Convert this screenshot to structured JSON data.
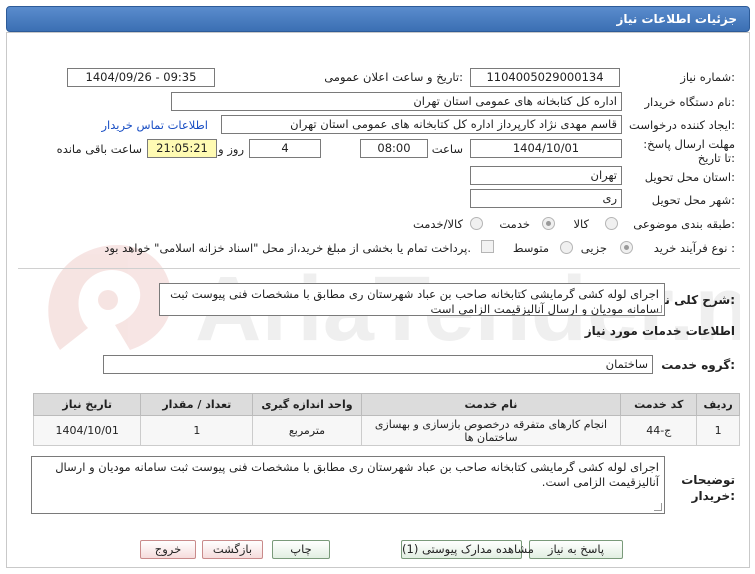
{
  "window_title": "جزئیات اطلاعات نیاز",
  "watermark_text": "AriaTender.net",
  "fields": {
    "need_number_label": "شماره نیاز:",
    "need_number": "1104005029000134",
    "announce_label": "تاریخ و ساعت اعلان عمومی:",
    "announce_value": "1404/09/26 - 09:35",
    "buyer_org_label": "نام دستگاه خریدار:",
    "buyer_org": "اداره کل کتابخانه های عمومی استان تهران",
    "creator_label": "ایجاد کننده درخواست:",
    "creator": "قاسم مهدی نژاد کارپرداز اداره کل کتابخانه های عمومی استان تهران",
    "contact_link": "اطلاعات تماس خریدار",
    "deadline_label": "مهلت ارسال پاسخ: تا تاریخ:",
    "deadline_date": "1404/10/01",
    "time_label": "ساعت",
    "deadline_time": "08:00",
    "days_value": "4",
    "days_label": "روز و",
    "remaining_time": "21:05:21",
    "remaining_label": "ساعت باقی مانده",
    "province_label": "استان محل تحویل:",
    "province": "تهران",
    "city_label": "شهر محل تحویل:",
    "city": "ری",
    "category_label": "طبقه بندی موضوعی:",
    "category_options": [
      "کالا",
      "خدمت",
      "کالا/خدمت"
    ],
    "process_label": "نوع فرآیند خرید :",
    "process_options": [
      "جزیی",
      "متوسط"
    ],
    "payment_note": "پرداخت تمام یا بخشی از مبلغ خرید،از محل \"اسناد خزانه اسلامی\" خواهد بود."
  },
  "description": {
    "label": "شرح کلی نیاز:",
    "text": "اجرای لوله کشی گرمایشی کتابخانه صاحب بن عباد شهرستان ری مطابق با مشخصات فنی پیوست ثبت سامانه مودیان و ارسال آنالیزقیمت الزامی است"
  },
  "services": {
    "section_title": "اطلاعات خدمات مورد نیاز",
    "group_label": "گروه خدمت:",
    "group_value": "ساختمان",
    "columns": [
      "ردیف",
      "کد خدمت",
      "نام خدمت",
      "واحد اندازه گیری",
      "تعداد / مقدار",
      "تاریخ نیاز"
    ],
    "rows": [
      [
        "1",
        "ج-44",
        "انجام کارهای متفرقه درخصوص بازسازی و بهسازی ساختمان ها",
        "مترمربع",
        "1",
        "1404/10/01"
      ]
    ]
  },
  "buyer_notes": {
    "label": "توضیحات خریدار:",
    "text": "اجرای لوله کشی گرمایشی کتابخانه صاحب بن عباد شهرستان ری مطابق با مشخصات فنی پیوست ثبت سامانه مودیان و ارسال آنالیزقیمت الزامی است."
  },
  "buttons": {
    "reply": "پاسخ به نیاز",
    "attachments": "مشاهده مدارک پیوستی (1)",
    "print": "چاپ",
    "back": "بازگشت",
    "exit": "خروج"
  }
}
